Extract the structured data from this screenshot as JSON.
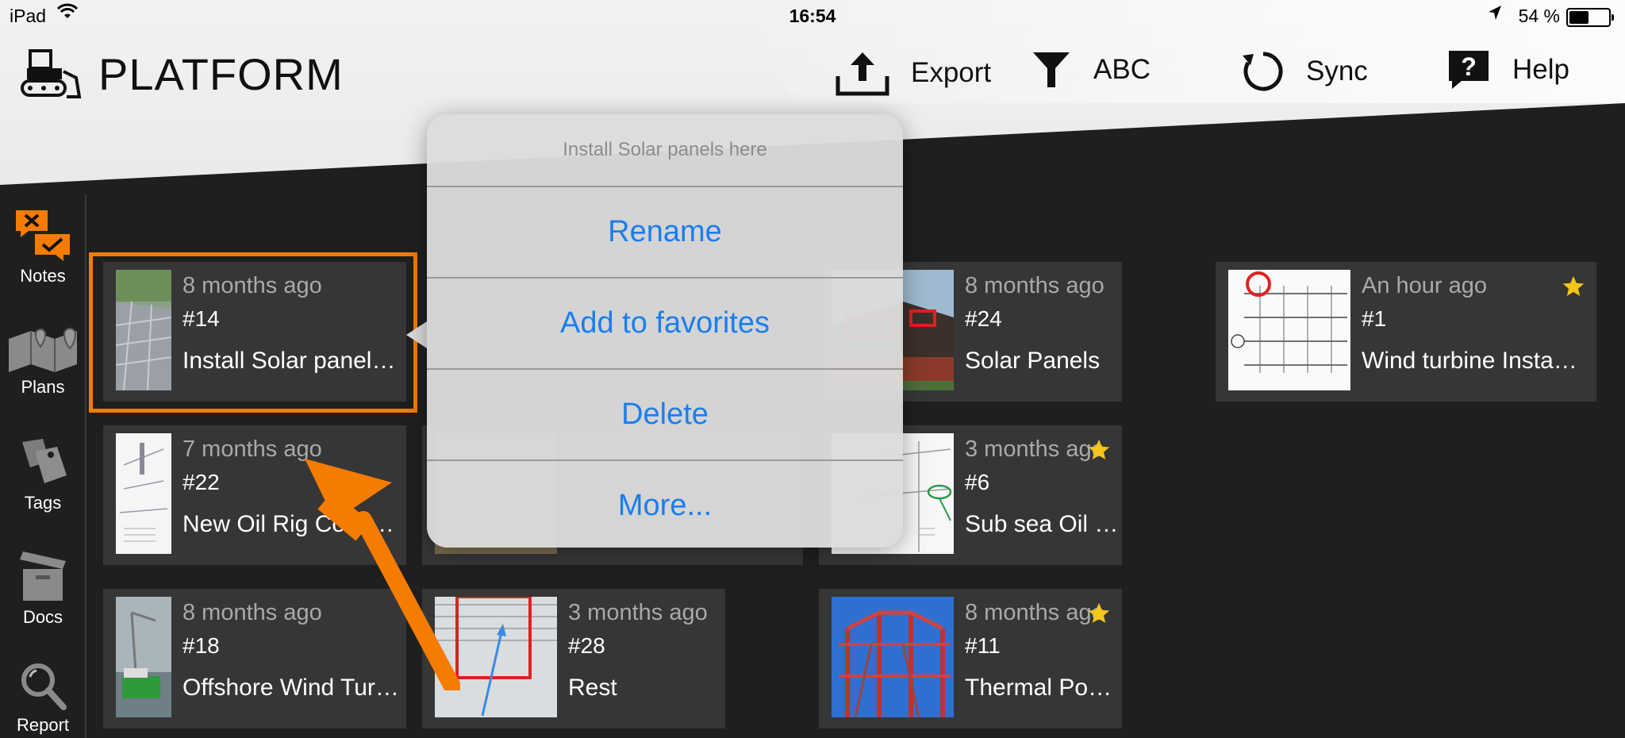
{
  "status_bar": {
    "device": "iPad",
    "time": "16:54",
    "battery": "54 %",
    "battery_level": 0.54
  },
  "app": {
    "title": "PLATFORM"
  },
  "toolbar": {
    "export": "Export",
    "filter": "ABC",
    "sync": "Sync",
    "help": "Help"
  },
  "sidebar": {
    "notes": "Notes",
    "plans": "Plans",
    "tags": "Tags",
    "docs": "Docs",
    "report": "Report"
  },
  "cards": [
    {
      "time": "8 months ago",
      "num": "#14",
      "title": "Install Solar panel…",
      "favorite": false
    },
    {
      "time": "8 months ago",
      "num": "#24",
      "title": "Solar Panels",
      "favorite": false
    },
    {
      "time": "An hour ago",
      "num": "#1",
      "title": "Wind turbine Insta…",
      "favorite": true
    },
    {
      "time": "7 months ago",
      "num": "#22",
      "title": "New Oil Rig Const…",
      "favorite": false
    },
    {
      "time": "3 months ago",
      "num": "#6",
      "title": "Sub sea Oil Link",
      "favorite": true
    },
    {
      "time": "8 months ago",
      "num": "#18",
      "title": "Offshore Wind Tur…",
      "favorite": false
    },
    {
      "time": "3 months ago",
      "num": "#28",
      "title": "Rest",
      "favorite": false
    },
    {
      "time": "8 months ago",
      "num": "#11",
      "title": "Thermal Power Pla…",
      "favorite": true
    }
  ],
  "popover": {
    "title": "Install Solar panels here",
    "items": [
      "Rename",
      "Add to favorites",
      "Delete",
      "More..."
    ]
  },
  "colors": {
    "accent": "#f57c00",
    "ios_blue": "#1a7ef0",
    "card_bg": "#363636",
    "star": "#f5c518"
  }
}
